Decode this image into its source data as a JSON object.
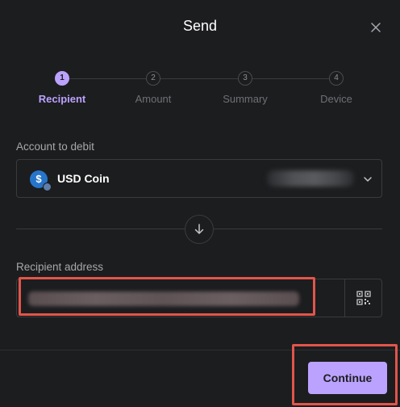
{
  "dialog": {
    "title": "Send",
    "close_icon": "close-icon"
  },
  "stepper": {
    "active_step": 1,
    "steps": [
      {
        "number": "1",
        "label": "Recipient"
      },
      {
        "number": "2",
        "label": "Amount"
      },
      {
        "number": "3",
        "label": "Summary"
      },
      {
        "number": "4",
        "label": "Device"
      }
    ]
  },
  "account": {
    "label": "Account to debit",
    "name": "USD Coin",
    "icon": "usd-coin-icon",
    "balance_redacted": true
  },
  "direction_icon": "arrow-down-icon",
  "recipient": {
    "label": "Recipient address",
    "value_redacted": true,
    "qr_icon": "qr-code-icon"
  },
  "footer": {
    "continue_label": "Continue"
  },
  "colors": {
    "accent": "#bba2ff",
    "background": "#1c1d1f",
    "highlight": "#e2554a",
    "usdc_blue": "#2775ca"
  }
}
